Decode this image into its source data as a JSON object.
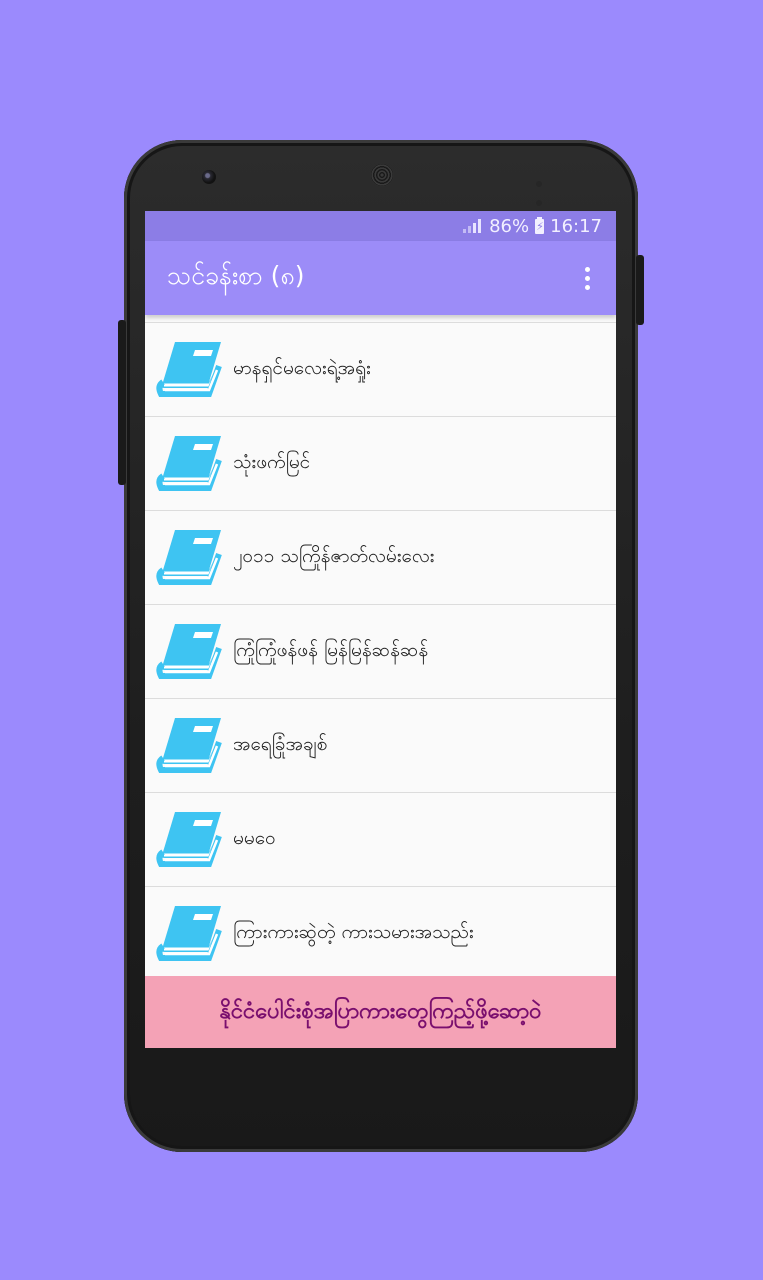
{
  "status_bar": {
    "battery": "86%",
    "time": "16:17"
  },
  "app_bar": {
    "title": "သင်ခန်းစာ (၈)"
  },
  "list": {
    "items": [
      {
        "label": "မာနရှင်မလေးရဲ့အရှုံး"
      },
      {
        "label": "သုံးဖက်မြင်"
      },
      {
        "label": "၂၀၁၁ သကြိုန်ဇာတ်လမ်းလေး"
      },
      {
        "label": "ကြုံကြုံဖန်ဖန် မြန်မြန်ဆန်ဆန်"
      },
      {
        "label": "အရေခြုံအချစ်"
      },
      {
        "label": "မမဝေ"
      },
      {
        "label": "ကြားကားဆွဲတဲ့ ကားသမားအသည်း"
      }
    ]
  },
  "banner": {
    "text": "နိုင်ငံပေါင်းစုံအပြာကားတွေကြည့်ဖို့ဆော့ဝဲ"
  },
  "colors": {
    "background": "#9b8afd",
    "app_bar": "#9c8cf8",
    "status_bar": "#8c7de6",
    "book_icon": "#3ec4f2",
    "banner_bg": "#f4a2b6",
    "banner_text": "#7a0f6e"
  },
  "icons": {
    "list_item": "book-icon",
    "overflow": "more-vert-icon"
  }
}
